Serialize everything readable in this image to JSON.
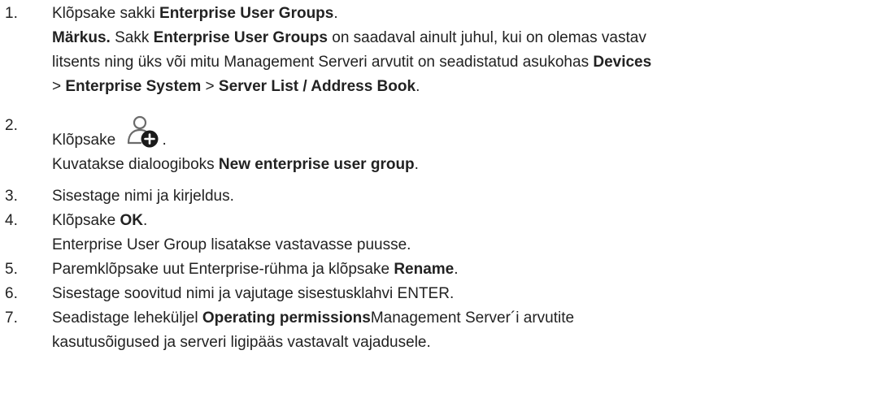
{
  "steps": [
    {
      "number": "1.",
      "lines": [
        {
          "parts": [
            {
              "t": "Klõpsake sakki "
            },
            {
              "b": "Enterprise User Groups"
            },
            {
              "t": "."
            }
          ]
        },
        {
          "parts": [
            {
              "b": "Märkus."
            },
            {
              "t": " Sakk "
            },
            {
              "b": "Enterprise User Groups"
            },
            {
              "t": " on saadaval ainult juhul, kui on olemas vastav"
            }
          ]
        },
        {
          "parts": [
            {
              "t": "litsents ning üks või mitu Management Serveri arvutit on seadistatud asukohas "
            },
            {
              "b": "Devices"
            }
          ]
        },
        {
          "parts": [
            {
              "t": "> "
            },
            {
              "b": "Enterprise System"
            },
            {
              "t": " > "
            },
            {
              "b": "Server List / Address Book"
            },
            {
              "t": "."
            }
          ]
        }
      ]
    },
    {
      "number": "2.",
      "lines": [
        {
          "parts": [
            {
              "t": "Klõpsake "
            },
            {
              "icon": "add-user-group-icon"
            },
            {
              "t": "."
            }
          ]
        },
        {
          "parts": [
            {
              "t": "Kuvatakse dialoogiboks "
            },
            {
              "b": "New enterprise user group"
            },
            {
              "t": "."
            }
          ]
        }
      ]
    },
    {
      "number": "3.",
      "lines": [
        {
          "parts": [
            {
              "t": "Sisestage nimi ja kirjeldus."
            }
          ]
        }
      ]
    },
    {
      "number": "4.",
      "lines": [
        {
          "parts": [
            {
              "t": "Klõpsake "
            },
            {
              "b": "OK"
            },
            {
              "t": "."
            }
          ]
        },
        {
          "parts": [
            {
              "t": "Enterprise User Group lisatakse vastavasse puusse."
            }
          ]
        }
      ]
    },
    {
      "number": "5.",
      "lines": [
        {
          "parts": [
            {
              "t": "Paremklõpsake uut Enterprise-rühma ja klõpsake "
            },
            {
              "b": "Rename"
            },
            {
              "t": "."
            }
          ]
        }
      ]
    },
    {
      "number": "6.",
      "lines": [
        {
          "parts": [
            {
              "t": "Sisestage soovitud nimi ja vajutage sisestusklahvi ENTER."
            }
          ]
        }
      ]
    },
    {
      "number": "7.",
      "lines": [
        {
          "parts": [
            {
              "t": "Seadistage leheküljel "
            },
            {
              "b": "Operating permissions"
            },
            {
              "t": "Management Server´i arvutite"
            }
          ]
        },
        {
          "parts": [
            {
              "t": "kasutusõigused ja serveri ligipääs vastavalt vajadusele."
            }
          ]
        }
      ]
    }
  ]
}
